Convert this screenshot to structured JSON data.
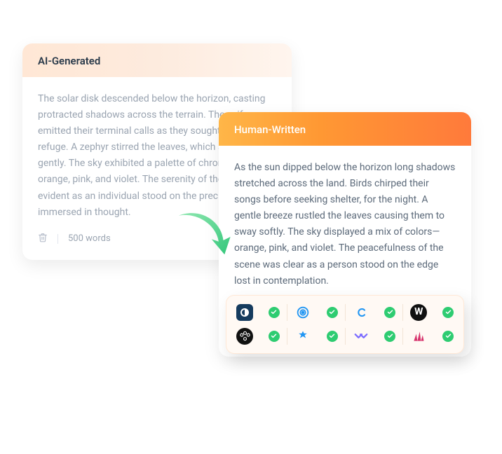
{
  "ai_card": {
    "title": "AI-Generated",
    "body": "The solar disk descended below the horizon, casting protracted shadows across the terrain. The avifauna emitted their terminal calls as they sought nocturnal refuge. A zephyr stirred the leaves, which swayed gently. The sky exhibited a palette of chromatic hues—orange, pink, and violet. The serenity of the setting was evident as an individual stood on the precipice, immersed in thought.",
    "word_count": "500 words"
  },
  "human_card": {
    "title": "Human-Written",
    "body": "As the sun dipped below the horizon long shadows stretched across the land. Birds chirped their songs before seeking shelter, for the night. A gentle breeze rustled the leaves causing them to sway softly. The sky displayed a mix of colors—orange, pink, and violet. The peacefulness of the scene was clear as a person stood on the edge lost in contemplation."
  },
  "detectors": {
    "row1": [
      {
        "name": "gptzero",
        "pass": true
      },
      {
        "name": "originality",
        "pass": true
      },
      {
        "name": "copyleaks",
        "pass": true
      },
      {
        "name": "writer",
        "pass": true
      }
    ],
    "row2": [
      {
        "name": "openai",
        "pass": true
      },
      {
        "name": "sapling",
        "pass": true
      },
      {
        "name": "crossplag",
        "pass": true
      },
      {
        "name": "contentscale",
        "pass": true
      }
    ]
  }
}
